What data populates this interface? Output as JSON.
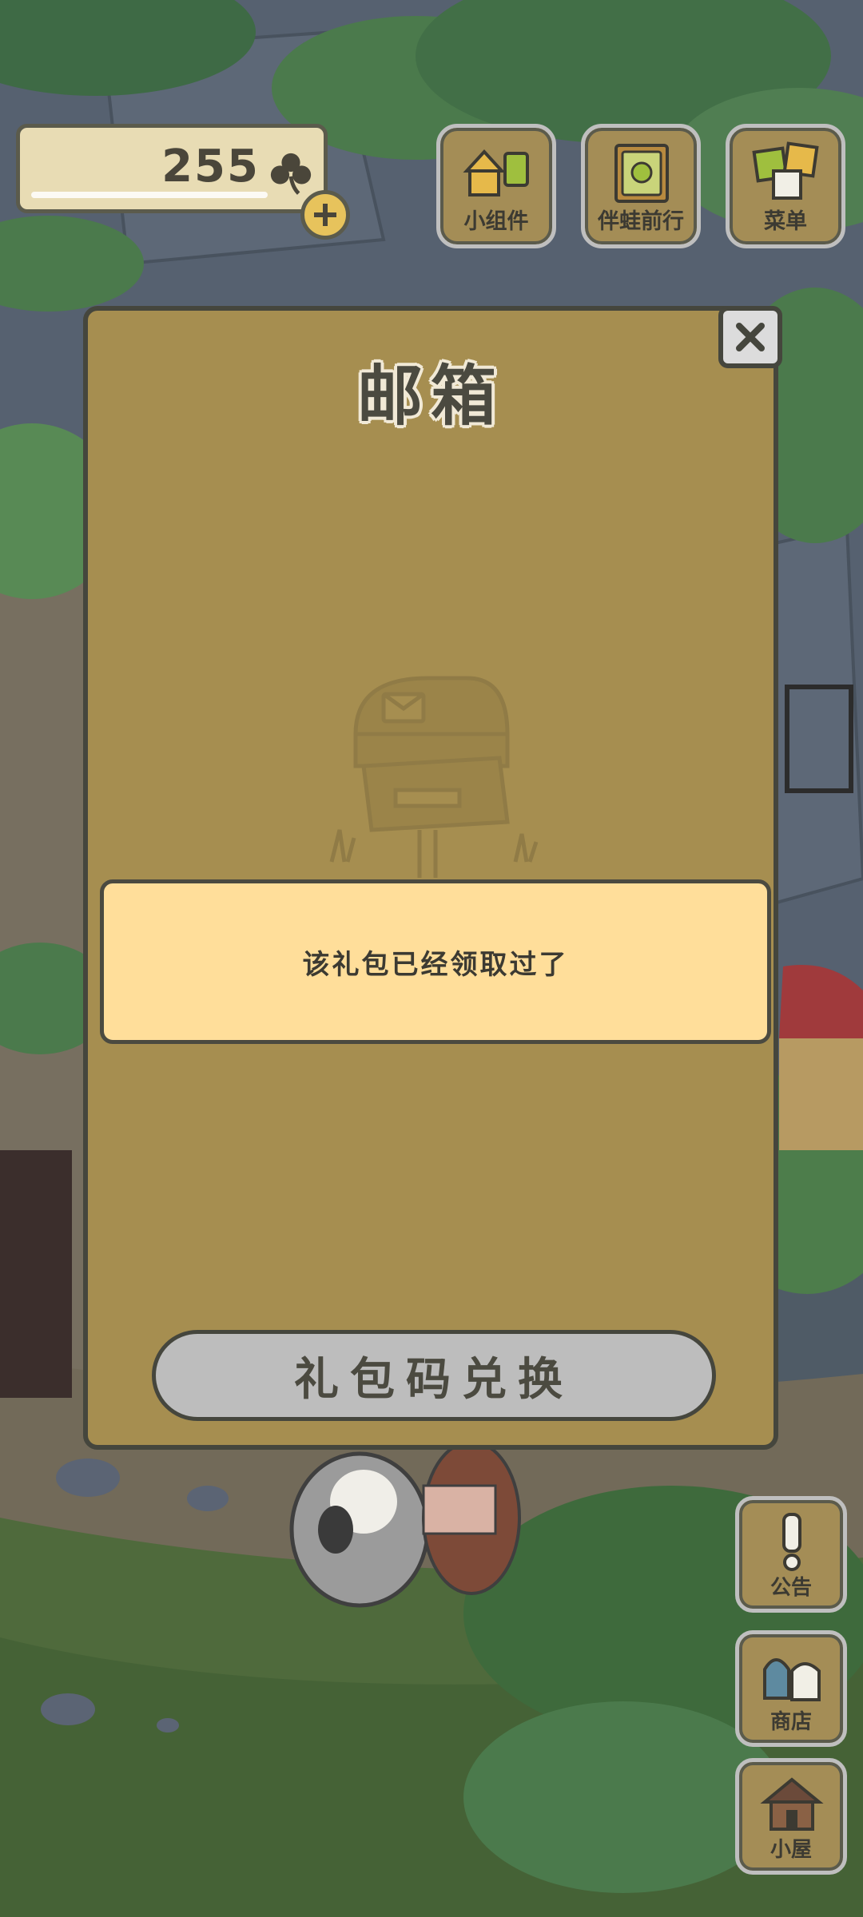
{
  "currency": {
    "clover_count": "255",
    "icon": "clover-icon",
    "add_icon": "plus-icon"
  },
  "top_menu": [
    {
      "label": "小组件",
      "icon": "widgets-icon"
    },
    {
      "label": "伴蛙前行",
      "icon": "journey-book-icon"
    },
    {
      "label": "菜单",
      "icon": "menu-cards-icon"
    }
  ],
  "dialog": {
    "title": "邮箱",
    "close_icon": "close-icon",
    "illustration": "mailbox-icon",
    "message": "该礼包已经领取过了",
    "redeem_button_label": "礼包码兑换"
  },
  "side_menu": [
    {
      "label": "公告",
      "icon": "exclamation-icon"
    },
    {
      "label": "商店",
      "icon": "shop-bags-icon"
    },
    {
      "label": "小屋",
      "icon": "house-icon"
    }
  ],
  "colors": {
    "dialog_bg": "#a68e50",
    "message_bg": "#ffde9a",
    "button_gray": "#bdbdbd",
    "outline": "#45463d"
  }
}
